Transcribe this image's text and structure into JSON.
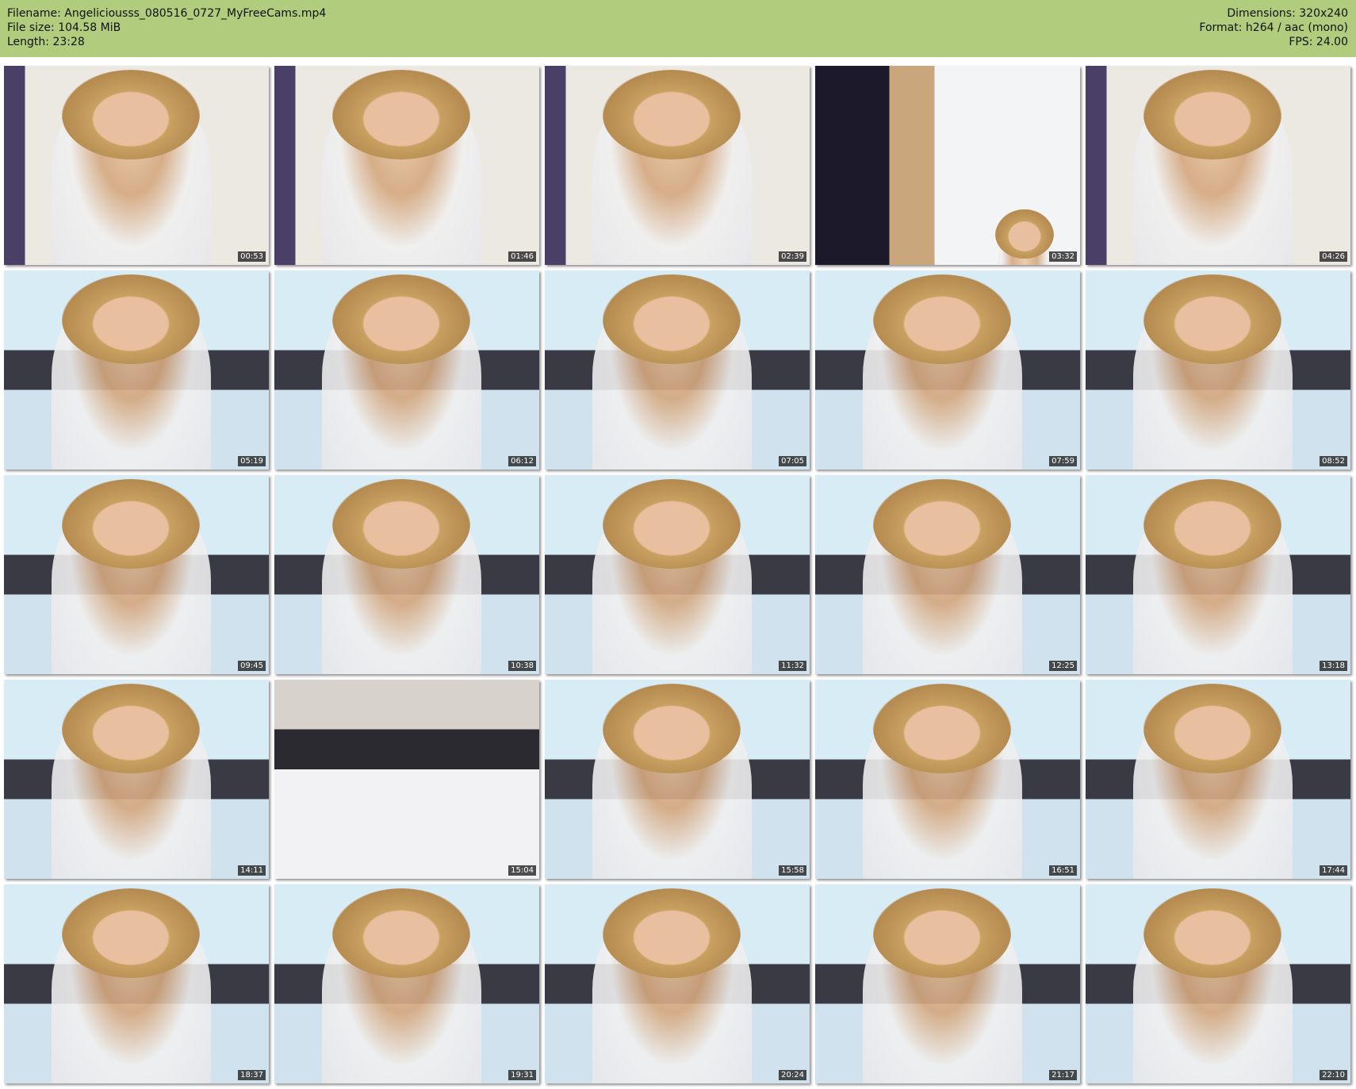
{
  "header": {
    "filename": "Filename: Angeliciousss_080516_0727_MyFreeCams.mp4",
    "file_size": "File size: 104.58 MiB",
    "length": "Length: 23:28",
    "dimensions": "Dimensions: 320x240",
    "format": "Format: h264 / aac (mono)",
    "fps": "FPS: 24.00"
  },
  "thumbnails": [
    {
      "time": "00:53"
    },
    {
      "time": "01:46"
    },
    {
      "time": "02:39"
    },
    {
      "time": "03:32"
    },
    {
      "time": "04:26"
    },
    {
      "time": "05:19"
    },
    {
      "time": "06:12"
    },
    {
      "time": "07:05"
    },
    {
      "time": "07:59"
    },
    {
      "time": "08:52"
    },
    {
      "time": "09:45"
    },
    {
      "time": "10:38"
    },
    {
      "time": "11:32"
    },
    {
      "time": "12:25"
    },
    {
      "time": "13:18"
    },
    {
      "time": "14:11"
    },
    {
      "time": "15:04"
    },
    {
      "time": "15:58"
    },
    {
      "time": "16:51"
    },
    {
      "time": "17:44"
    },
    {
      "time": "18:37"
    },
    {
      "time": "19:31"
    },
    {
      "time": "20:24"
    },
    {
      "time": "21:17"
    },
    {
      "time": "22:10"
    }
  ],
  "colors": {
    "header_bg": "#b0cc7c",
    "wall_early": "#e9e3dc",
    "wall_late": "#cfe6f2"
  }
}
